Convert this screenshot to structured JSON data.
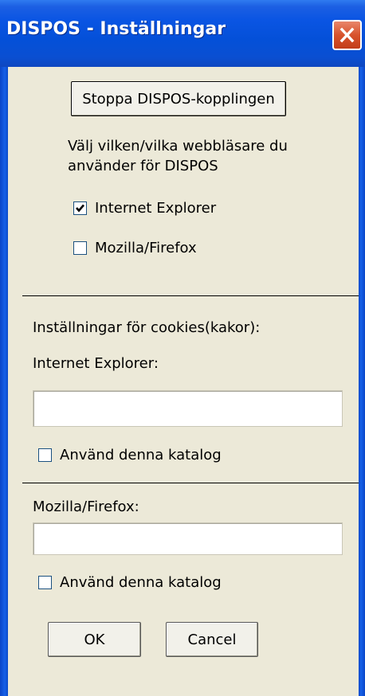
{
  "window": {
    "title": "DISPOS - Inställningar",
    "close_icon": "close-icon"
  },
  "main": {
    "stop_button_label": "Stoppa DISPOS-kopplingen",
    "browser_prompt_line1": "Välj vilken/vilka webbläsare du",
    "browser_prompt_line2": "använder för DISPOS",
    "ie_checkbox": {
      "label": "Internet Explorer",
      "checked": true
    },
    "firefox_checkbox": {
      "label": "Mozilla/Firefox",
      "checked": false
    }
  },
  "cookies": {
    "heading": "Inställningar för cookies(kakor):",
    "ie": {
      "label": "Internet Explorer:",
      "path_value": "",
      "use_dir_checkbox": {
        "label": "Använd denna katalog",
        "checked": false
      }
    },
    "firefox": {
      "label": "Mozilla/Firefox:",
      "path_value": "",
      "use_dir_checkbox": {
        "label": "Använd denna katalog",
        "checked": false
      }
    }
  },
  "footer": {
    "ok_label": "OK",
    "cancel_label": "Cancel"
  },
  "colors": {
    "title_bar": "#0450d8",
    "window_bg": "#ECE9D8",
    "close_button": "#d8532c"
  }
}
